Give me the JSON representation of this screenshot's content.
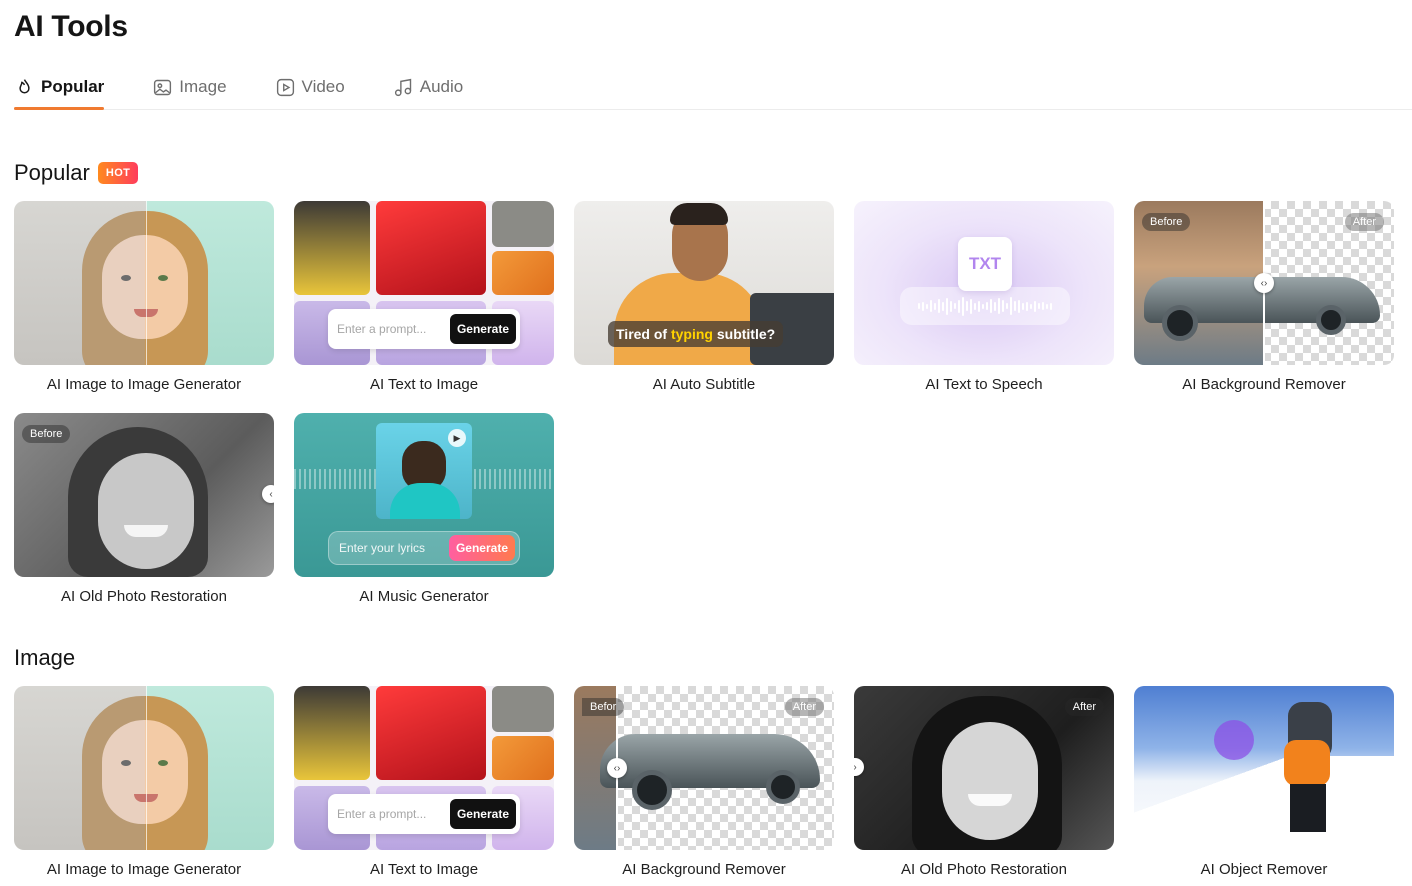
{
  "page": {
    "title": "AI Tools"
  },
  "tabs": [
    {
      "label": "Popular",
      "icon": "flame-icon",
      "active": true
    },
    {
      "label": "Image",
      "icon": "image-icon",
      "active": false
    },
    {
      "label": "Video",
      "icon": "play-icon",
      "active": false
    },
    {
      "label": "Audio",
      "icon": "music-note-icon",
      "active": false
    }
  ],
  "sections": {
    "popular": {
      "title": "Popular",
      "badge": "HOT",
      "cards": [
        {
          "label": "AI Image to Image Generator"
        },
        {
          "label": "AI Text to Image",
          "prompt_placeholder": "Enter a prompt...",
          "button": "Generate"
        },
        {
          "label": "AI Auto Subtitle",
          "caption_pre": "Tired of",
          "caption_highlight": "typing",
          "caption_post": "subtitle?"
        },
        {
          "label": "AI Text to Speech",
          "doc_text": "TXT"
        },
        {
          "label": "AI Background Remover",
          "before": "Before",
          "after": "After"
        },
        {
          "label": "AI Old Photo Restoration",
          "before": "Before"
        },
        {
          "label": "AI Music Generator",
          "lyrics_placeholder": "Enter your lyrics",
          "button": "Generate"
        }
      ]
    },
    "image": {
      "title": "Image",
      "cards": [
        {
          "label": "AI Image to Image Generator"
        },
        {
          "label": "AI Text to Image",
          "prompt_placeholder": "Enter a prompt...",
          "button": "Generate"
        },
        {
          "label": "AI Background Remover",
          "before": "Befor",
          "after": "After"
        },
        {
          "label": "AI Old Photo Restoration",
          "after": "After"
        },
        {
          "label": "AI Object Remover"
        }
      ]
    }
  },
  "colors": {
    "accent": "#f07a30",
    "hot_badge_from": "#ff8a1e",
    "hot_badge_to": "#ff3c5c"
  }
}
